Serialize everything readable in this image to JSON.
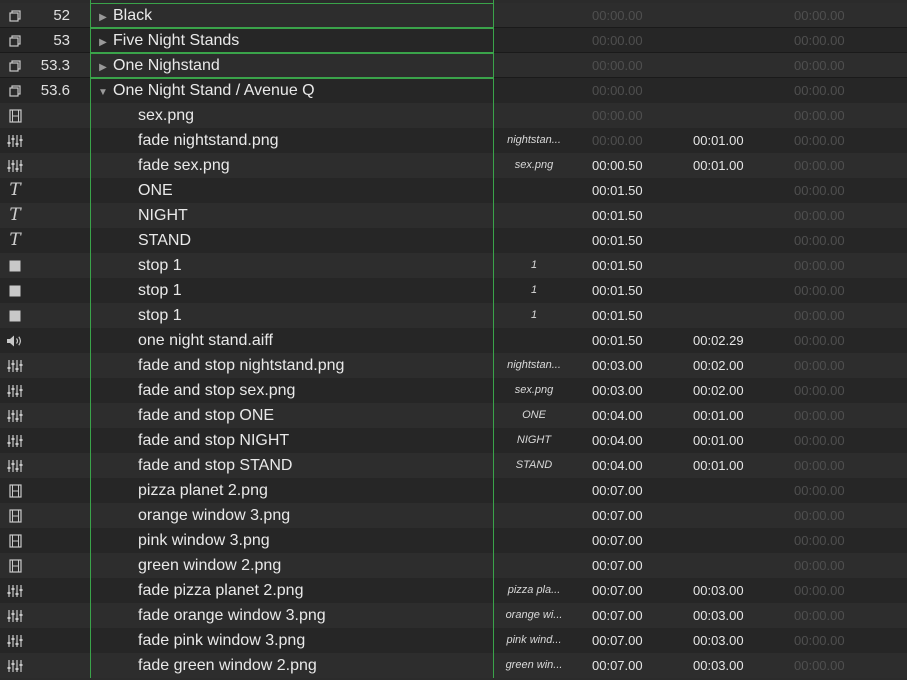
{
  "columns": [
    "icon",
    "number",
    "name",
    "target",
    "pre_wait",
    "action",
    "post_wait"
  ],
  "rows": [
    {
      "icon": "group-icon",
      "number": "52",
      "name": "Black",
      "kind": "group",
      "expanded": false,
      "target": "",
      "pre": "00:00.00",
      "act": "",
      "post": "00:00.00",
      "pre_dim": true,
      "post_dim": true
    },
    {
      "icon": "group-icon",
      "number": "53",
      "name": "Five Night Stands",
      "kind": "group",
      "expanded": false,
      "target": "",
      "pre": "00:00.00",
      "act": "",
      "post": "00:00.00",
      "pre_dim": true,
      "post_dim": true
    },
    {
      "icon": "group-icon",
      "number": "53.3",
      "name": "One Nighstand",
      "kind": "group",
      "expanded": false,
      "target": "",
      "pre": "00:00.00",
      "act": "",
      "post": "00:00.00",
      "pre_dim": true,
      "post_dim": true
    },
    {
      "icon": "group-icon",
      "number": "53.6",
      "name": "One Night Stand / Avenue Q",
      "kind": "group",
      "expanded": true,
      "target": "",
      "pre": "00:00.00",
      "act": "",
      "post": "00:00.00",
      "pre_dim": true,
      "post_dim": true
    },
    {
      "icon": "video-icon",
      "number": "",
      "name": "sex.png",
      "kind": "child",
      "target": "",
      "pre": "00:00.00",
      "act": "",
      "post": "00:00.00",
      "pre_dim": true,
      "post_dim": true
    },
    {
      "icon": "fade-icon",
      "number": "",
      "name": "fade nightstand.png",
      "kind": "child",
      "target": "nightstan...",
      "pre": "00:00.00",
      "act": "00:01.00",
      "post": "00:00.00",
      "pre_dim": true,
      "post_dim": true
    },
    {
      "icon": "fade-icon",
      "number": "",
      "name": "fade sex.png",
      "kind": "child",
      "target": "sex.png",
      "pre": "00:00.50",
      "act": "00:01.00",
      "post": "00:00.00",
      "pre_dim": false,
      "post_dim": true
    },
    {
      "icon": "text-icon",
      "number": "",
      "name": "ONE",
      "kind": "child",
      "target": "",
      "pre": "00:01.50",
      "act": "",
      "post": "00:00.00",
      "pre_dim": false,
      "post_dim": true
    },
    {
      "icon": "text-icon",
      "number": "",
      "name": "NIGHT",
      "kind": "child",
      "target": "",
      "pre": "00:01.50",
      "act": "",
      "post": "00:00.00",
      "pre_dim": false,
      "post_dim": true
    },
    {
      "icon": "text-icon",
      "number": "",
      "name": "STAND",
      "kind": "child",
      "target": "",
      "pre": "00:01.50",
      "act": "",
      "post": "00:00.00",
      "pre_dim": false,
      "post_dim": true
    },
    {
      "icon": "stop-icon",
      "number": "",
      "name": "stop 1",
      "kind": "child",
      "target": "1",
      "pre": "00:01.50",
      "act": "",
      "post": "00:00.00",
      "pre_dim": false,
      "post_dim": true
    },
    {
      "icon": "stop-icon",
      "number": "",
      "name": "stop 1",
      "kind": "child",
      "target": "1",
      "pre": "00:01.50",
      "act": "",
      "post": "00:00.00",
      "pre_dim": false,
      "post_dim": true
    },
    {
      "icon": "stop-icon",
      "number": "",
      "name": "stop 1",
      "kind": "child",
      "target": "1",
      "pre": "00:01.50",
      "act": "",
      "post": "00:00.00",
      "pre_dim": false,
      "post_dim": true
    },
    {
      "icon": "audio-icon",
      "number": "",
      "name": "one night stand.aiff",
      "kind": "child",
      "target": "",
      "pre": "00:01.50",
      "act": "00:02.29",
      "post": "00:00.00",
      "pre_dim": false,
      "post_dim": true
    },
    {
      "icon": "fade-icon",
      "number": "",
      "name": "fade and stop nightstand.png",
      "kind": "child",
      "target": "nightstan...",
      "pre": "00:03.00",
      "act": "00:02.00",
      "post": "00:00.00",
      "pre_dim": false,
      "post_dim": true
    },
    {
      "icon": "fade-icon",
      "number": "",
      "name": "fade and stop sex.png",
      "kind": "child",
      "target": "sex.png",
      "pre": "00:03.00",
      "act": "00:02.00",
      "post": "00:00.00",
      "pre_dim": false,
      "post_dim": true
    },
    {
      "icon": "fade-icon",
      "number": "",
      "name": "fade and stop ONE",
      "kind": "child",
      "target": "ONE",
      "pre": "00:04.00",
      "act": "00:01.00",
      "post": "00:00.00",
      "pre_dim": false,
      "post_dim": true
    },
    {
      "icon": "fade-icon",
      "number": "",
      "name": "fade and stop NIGHT",
      "kind": "child",
      "target": "NIGHT",
      "pre": "00:04.00",
      "act": "00:01.00",
      "post": "00:00.00",
      "pre_dim": false,
      "post_dim": true
    },
    {
      "icon": "fade-icon",
      "number": "",
      "name": "fade and stop STAND",
      "kind": "child",
      "target": "STAND",
      "pre": "00:04.00",
      "act": "00:01.00",
      "post": "00:00.00",
      "pre_dim": false,
      "post_dim": true
    },
    {
      "icon": "video-icon",
      "number": "",
      "name": "pizza planet 2.png",
      "kind": "child",
      "target": "",
      "pre": "00:07.00",
      "act": "",
      "post": "00:00.00",
      "pre_dim": false,
      "post_dim": true
    },
    {
      "icon": "video-icon",
      "number": "",
      "name": "orange window 3.png",
      "kind": "child",
      "target": "",
      "pre": "00:07.00",
      "act": "",
      "post": "00:00.00",
      "pre_dim": false,
      "post_dim": true
    },
    {
      "icon": "video-icon",
      "number": "",
      "name": "pink window 3.png",
      "kind": "child",
      "target": "",
      "pre": "00:07.00",
      "act": "",
      "post": "00:00.00",
      "pre_dim": false,
      "post_dim": true
    },
    {
      "icon": "video-icon",
      "number": "",
      "name": "green window 2.png",
      "kind": "child",
      "target": "",
      "pre": "00:07.00",
      "act": "",
      "post": "00:00.00",
      "pre_dim": false,
      "post_dim": true
    },
    {
      "icon": "fade-icon",
      "number": "",
      "name": "fade pizza planet 2.png",
      "kind": "child",
      "target": "pizza pla...",
      "pre": "00:07.00",
      "act": "00:03.00",
      "post": "00:00.00",
      "pre_dim": false,
      "post_dim": true
    },
    {
      "icon": "fade-icon",
      "number": "",
      "name": "fade orange window 3.png",
      "kind": "child",
      "target": "orange wi...",
      "pre": "00:07.00",
      "act": "00:03.00",
      "post": "00:00.00",
      "pre_dim": false,
      "post_dim": true
    },
    {
      "icon": "fade-icon",
      "number": "",
      "name": "fade pink window 3.png",
      "kind": "child",
      "target": "pink wind...",
      "pre": "00:07.00",
      "act": "00:03.00",
      "post": "00:00.00",
      "pre_dim": false,
      "post_dim": true
    },
    {
      "icon": "fade-icon",
      "number": "",
      "name": "fade green window 2.png",
      "kind": "child",
      "target": "green win...",
      "pre": "00:07.00",
      "act": "00:03.00",
      "post": "00:00.00",
      "pre_dim": false,
      "post_dim": true
    }
  ],
  "colors": {
    "group_frame": "#3aa34a",
    "row_even": "#2d2d2d",
    "row_odd": "#262626",
    "dim_text": "#4f4f4f"
  }
}
